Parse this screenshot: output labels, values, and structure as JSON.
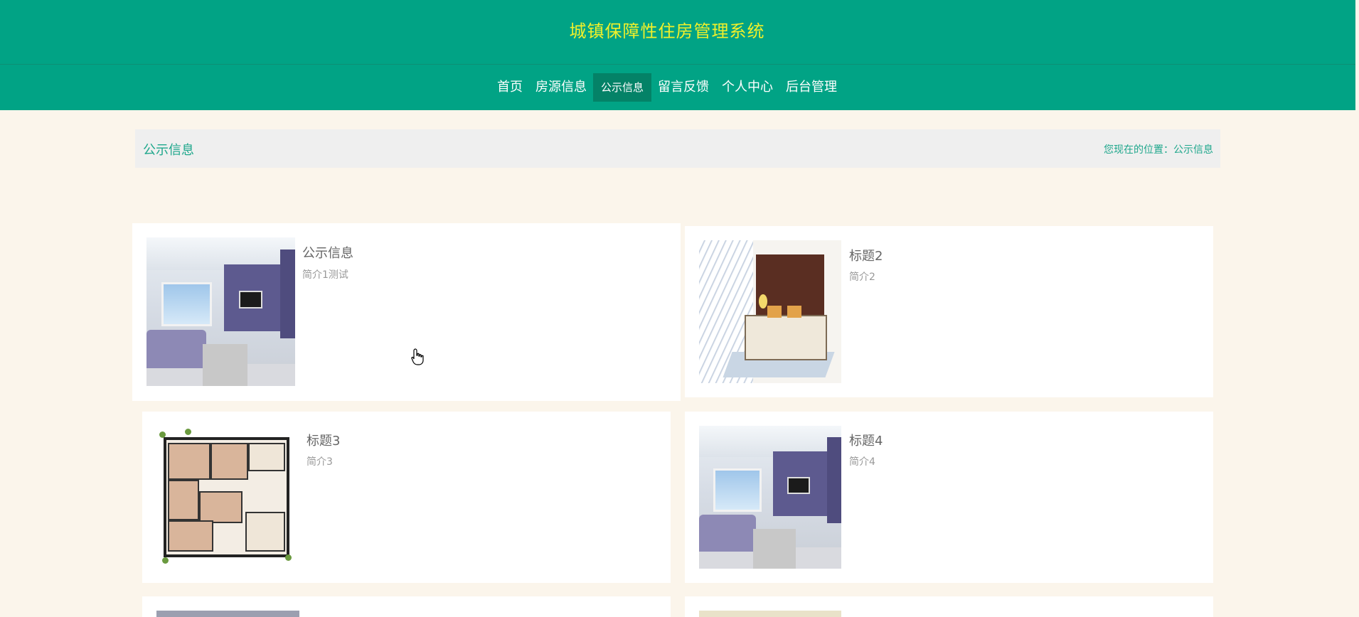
{
  "header": {
    "site_title": "城镇保障性住房管理系统",
    "nav": [
      {
        "label": "首页",
        "active": false
      },
      {
        "label": "房源信息",
        "active": false
      },
      {
        "label": "公示信息",
        "active": true
      },
      {
        "label": "留言反馈",
        "active": false
      },
      {
        "label": "个人中心",
        "active": false
      },
      {
        "label": "后台管理",
        "active": false
      }
    ]
  },
  "page": {
    "title": "公示信息",
    "breadcrumb": "您现在的位置：公示信息"
  },
  "cards": [
    {
      "title": "公示信息",
      "desc": "简介1测试",
      "thumb": "living-room-photo"
    },
    {
      "title": "标题2",
      "desc": "简介2",
      "thumb": "bedroom-sketch"
    },
    {
      "title": "标题3",
      "desc": "简介3",
      "thumb": "floor-plan"
    },
    {
      "title": "标题4",
      "desc": "简介4",
      "thumb": "living-room-photo"
    }
  ],
  "colors": {
    "header_bg": "#01a385",
    "nav_active_bg": "#048267",
    "site_title": "#f1f02a",
    "accent_text": "#1fa78c",
    "page_bg": "#fbf5eb"
  }
}
